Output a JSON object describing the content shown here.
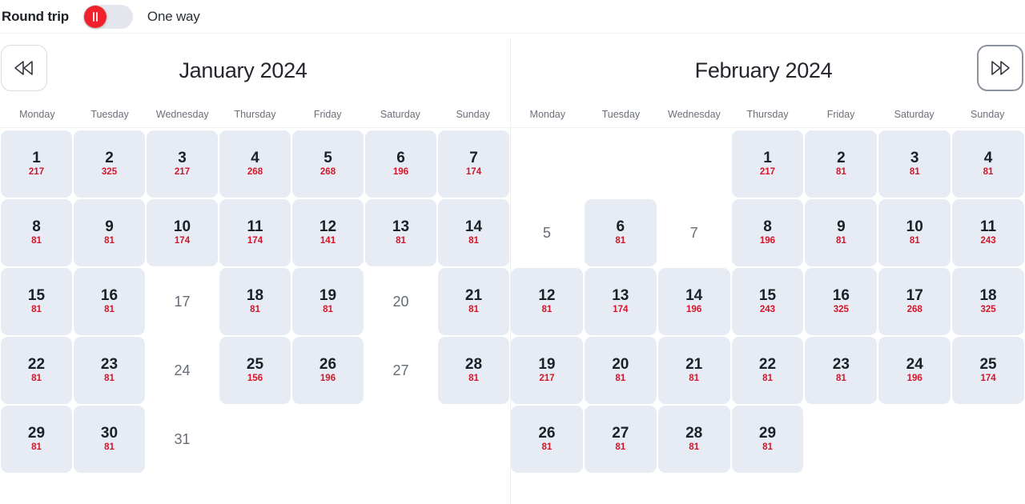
{
  "trip_selector": {
    "round_trip_label": "Round trip",
    "one_way_label": "One way",
    "selected": "Round trip",
    "toggle_accent_color": "#f0212d",
    "toggle_track_color": "#e3e6ed"
  },
  "nav": {
    "prev_icon": "double-chevron-left-icon",
    "next_icon": "double-chevron-right-icon",
    "prev_label": "Previous months",
    "next_label": "Next months"
  },
  "weekdays": [
    "Monday",
    "Tuesday",
    "Wednesday",
    "Thursday",
    "Friday",
    "Saturday",
    "Sunday"
  ],
  "theme": {
    "available_cell_bg": "#e7ebf3",
    "price_color": "#d4162a",
    "day_color": "#1b1f26",
    "disabled_day_color": "#666c75"
  },
  "calendars": [
    {
      "title": "January 2024",
      "month": "January",
      "year": "2024",
      "first_weekday_index": 0,
      "cells": [
        {
          "day": "1",
          "price": "217",
          "state": "available"
        },
        {
          "day": "2",
          "price": "325",
          "state": "available"
        },
        {
          "day": "3",
          "price": "217",
          "state": "available"
        },
        {
          "day": "4",
          "price": "268",
          "state": "available"
        },
        {
          "day": "5",
          "price": "268",
          "state": "available"
        },
        {
          "day": "6",
          "price": "196",
          "state": "available"
        },
        {
          "day": "7",
          "price": "174",
          "state": "available"
        },
        {
          "day": "8",
          "price": "81",
          "state": "available"
        },
        {
          "day": "9",
          "price": "81",
          "state": "available"
        },
        {
          "day": "10",
          "price": "174",
          "state": "available"
        },
        {
          "day": "11",
          "price": "174",
          "state": "available"
        },
        {
          "day": "12",
          "price": "141",
          "state": "available"
        },
        {
          "day": "13",
          "price": "81",
          "state": "available"
        },
        {
          "day": "14",
          "price": "81",
          "state": "available"
        },
        {
          "day": "15",
          "price": "81",
          "state": "available"
        },
        {
          "day": "16",
          "price": "81",
          "state": "available"
        },
        {
          "day": "17",
          "price": "",
          "state": "disabled"
        },
        {
          "day": "18",
          "price": "81",
          "state": "available"
        },
        {
          "day": "19",
          "price": "81",
          "state": "available"
        },
        {
          "day": "20",
          "price": "",
          "state": "disabled"
        },
        {
          "day": "21",
          "price": "81",
          "state": "available"
        },
        {
          "day": "22",
          "price": "81",
          "state": "available"
        },
        {
          "day": "23",
          "price": "81",
          "state": "available"
        },
        {
          "day": "24",
          "price": "",
          "state": "disabled"
        },
        {
          "day": "25",
          "price": "156",
          "state": "available"
        },
        {
          "day": "26",
          "price": "196",
          "state": "available"
        },
        {
          "day": "27",
          "price": "",
          "state": "disabled"
        },
        {
          "day": "28",
          "price": "81",
          "state": "available"
        },
        {
          "day": "29",
          "price": "81",
          "state": "available"
        },
        {
          "day": "30",
          "price": "81",
          "state": "available"
        },
        {
          "day": "31",
          "price": "",
          "state": "disabled"
        }
      ]
    },
    {
      "title": "February 2024",
      "month": "February",
      "year": "2024",
      "first_weekday_index": 3,
      "cells": [
        {
          "day": "1",
          "price": "217",
          "state": "available"
        },
        {
          "day": "2",
          "price": "81",
          "state": "available"
        },
        {
          "day": "3",
          "price": "81",
          "state": "available"
        },
        {
          "day": "4",
          "price": "81",
          "state": "available"
        },
        {
          "day": "5",
          "price": "",
          "state": "disabled"
        },
        {
          "day": "6",
          "price": "81",
          "state": "available"
        },
        {
          "day": "7",
          "price": "",
          "state": "disabled"
        },
        {
          "day": "8",
          "price": "196",
          "state": "available"
        },
        {
          "day": "9",
          "price": "81",
          "state": "available"
        },
        {
          "day": "10",
          "price": "81",
          "state": "available"
        },
        {
          "day": "11",
          "price": "243",
          "state": "available"
        },
        {
          "day": "12",
          "price": "81",
          "state": "available"
        },
        {
          "day": "13",
          "price": "174",
          "state": "available"
        },
        {
          "day": "14",
          "price": "196",
          "state": "available"
        },
        {
          "day": "15",
          "price": "243",
          "state": "available"
        },
        {
          "day": "16",
          "price": "325",
          "state": "available"
        },
        {
          "day": "17",
          "price": "268",
          "state": "available"
        },
        {
          "day": "18",
          "price": "325",
          "state": "available"
        },
        {
          "day": "19",
          "price": "217",
          "state": "available"
        },
        {
          "day": "20",
          "price": "81",
          "state": "available"
        },
        {
          "day": "21",
          "price": "81",
          "state": "available"
        },
        {
          "day": "22",
          "price": "81",
          "state": "available"
        },
        {
          "day": "23",
          "price": "81",
          "state": "available"
        },
        {
          "day": "24",
          "price": "196",
          "state": "available"
        },
        {
          "day": "25",
          "price": "174",
          "state": "available"
        },
        {
          "day": "26",
          "price": "81",
          "state": "available"
        },
        {
          "day": "27",
          "price": "81",
          "state": "available"
        },
        {
          "day": "28",
          "price": "81",
          "state": "available"
        },
        {
          "day": "29",
          "price": "81",
          "state": "available"
        }
      ]
    }
  ]
}
